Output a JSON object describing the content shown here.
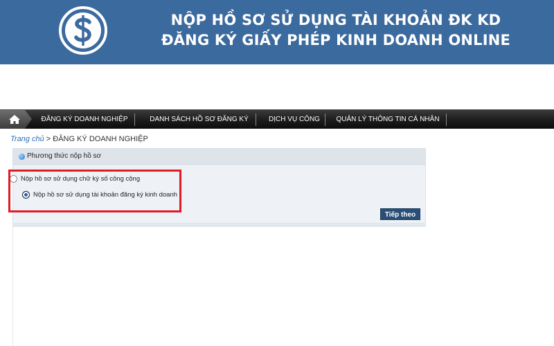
{
  "banner": {
    "line1": "NỘP HỒ SƠ SỬ DỤNG TÀI KHOẢN ĐK KD",
    "line2": "ĐĂNG KÝ GIẤY PHÉP KINH DOANH ONLINE",
    "logo_icon": "dollar-coin-icon",
    "background_color": "#3b6a9e"
  },
  "nav": {
    "home_icon": "home-icon",
    "items": [
      {
        "label": "ĐĂNG KÝ DOANH NGHIỆP"
      },
      {
        "label": "DANH SÁCH HỒ SƠ ĐĂNG KÝ"
      },
      {
        "label": "DỊCH VỤ CÔNG"
      },
      {
        "label": "QUẢN LÝ THÔNG TIN CÁ NHÂN"
      }
    ]
  },
  "breadcrumb": {
    "home": "Trang chủ",
    "separator": ">",
    "current": "ĐĂNG KÝ DOANH NGHIỆP"
  },
  "panel": {
    "title": "Phương thức nộp hồ sơ",
    "options": [
      {
        "label": "Nộp hồ sơ sử dụng chữ ký số công cộng",
        "selected": false
      },
      {
        "label": "Nộp hồ sơ sử dụng tài khoản đăng ký kinh doanh",
        "selected": true
      }
    ],
    "next_label": "Tiếp theo"
  },
  "colors": {
    "highlight": "#e01b24",
    "button": "#2a4f76",
    "link": "#2a6ebb"
  }
}
